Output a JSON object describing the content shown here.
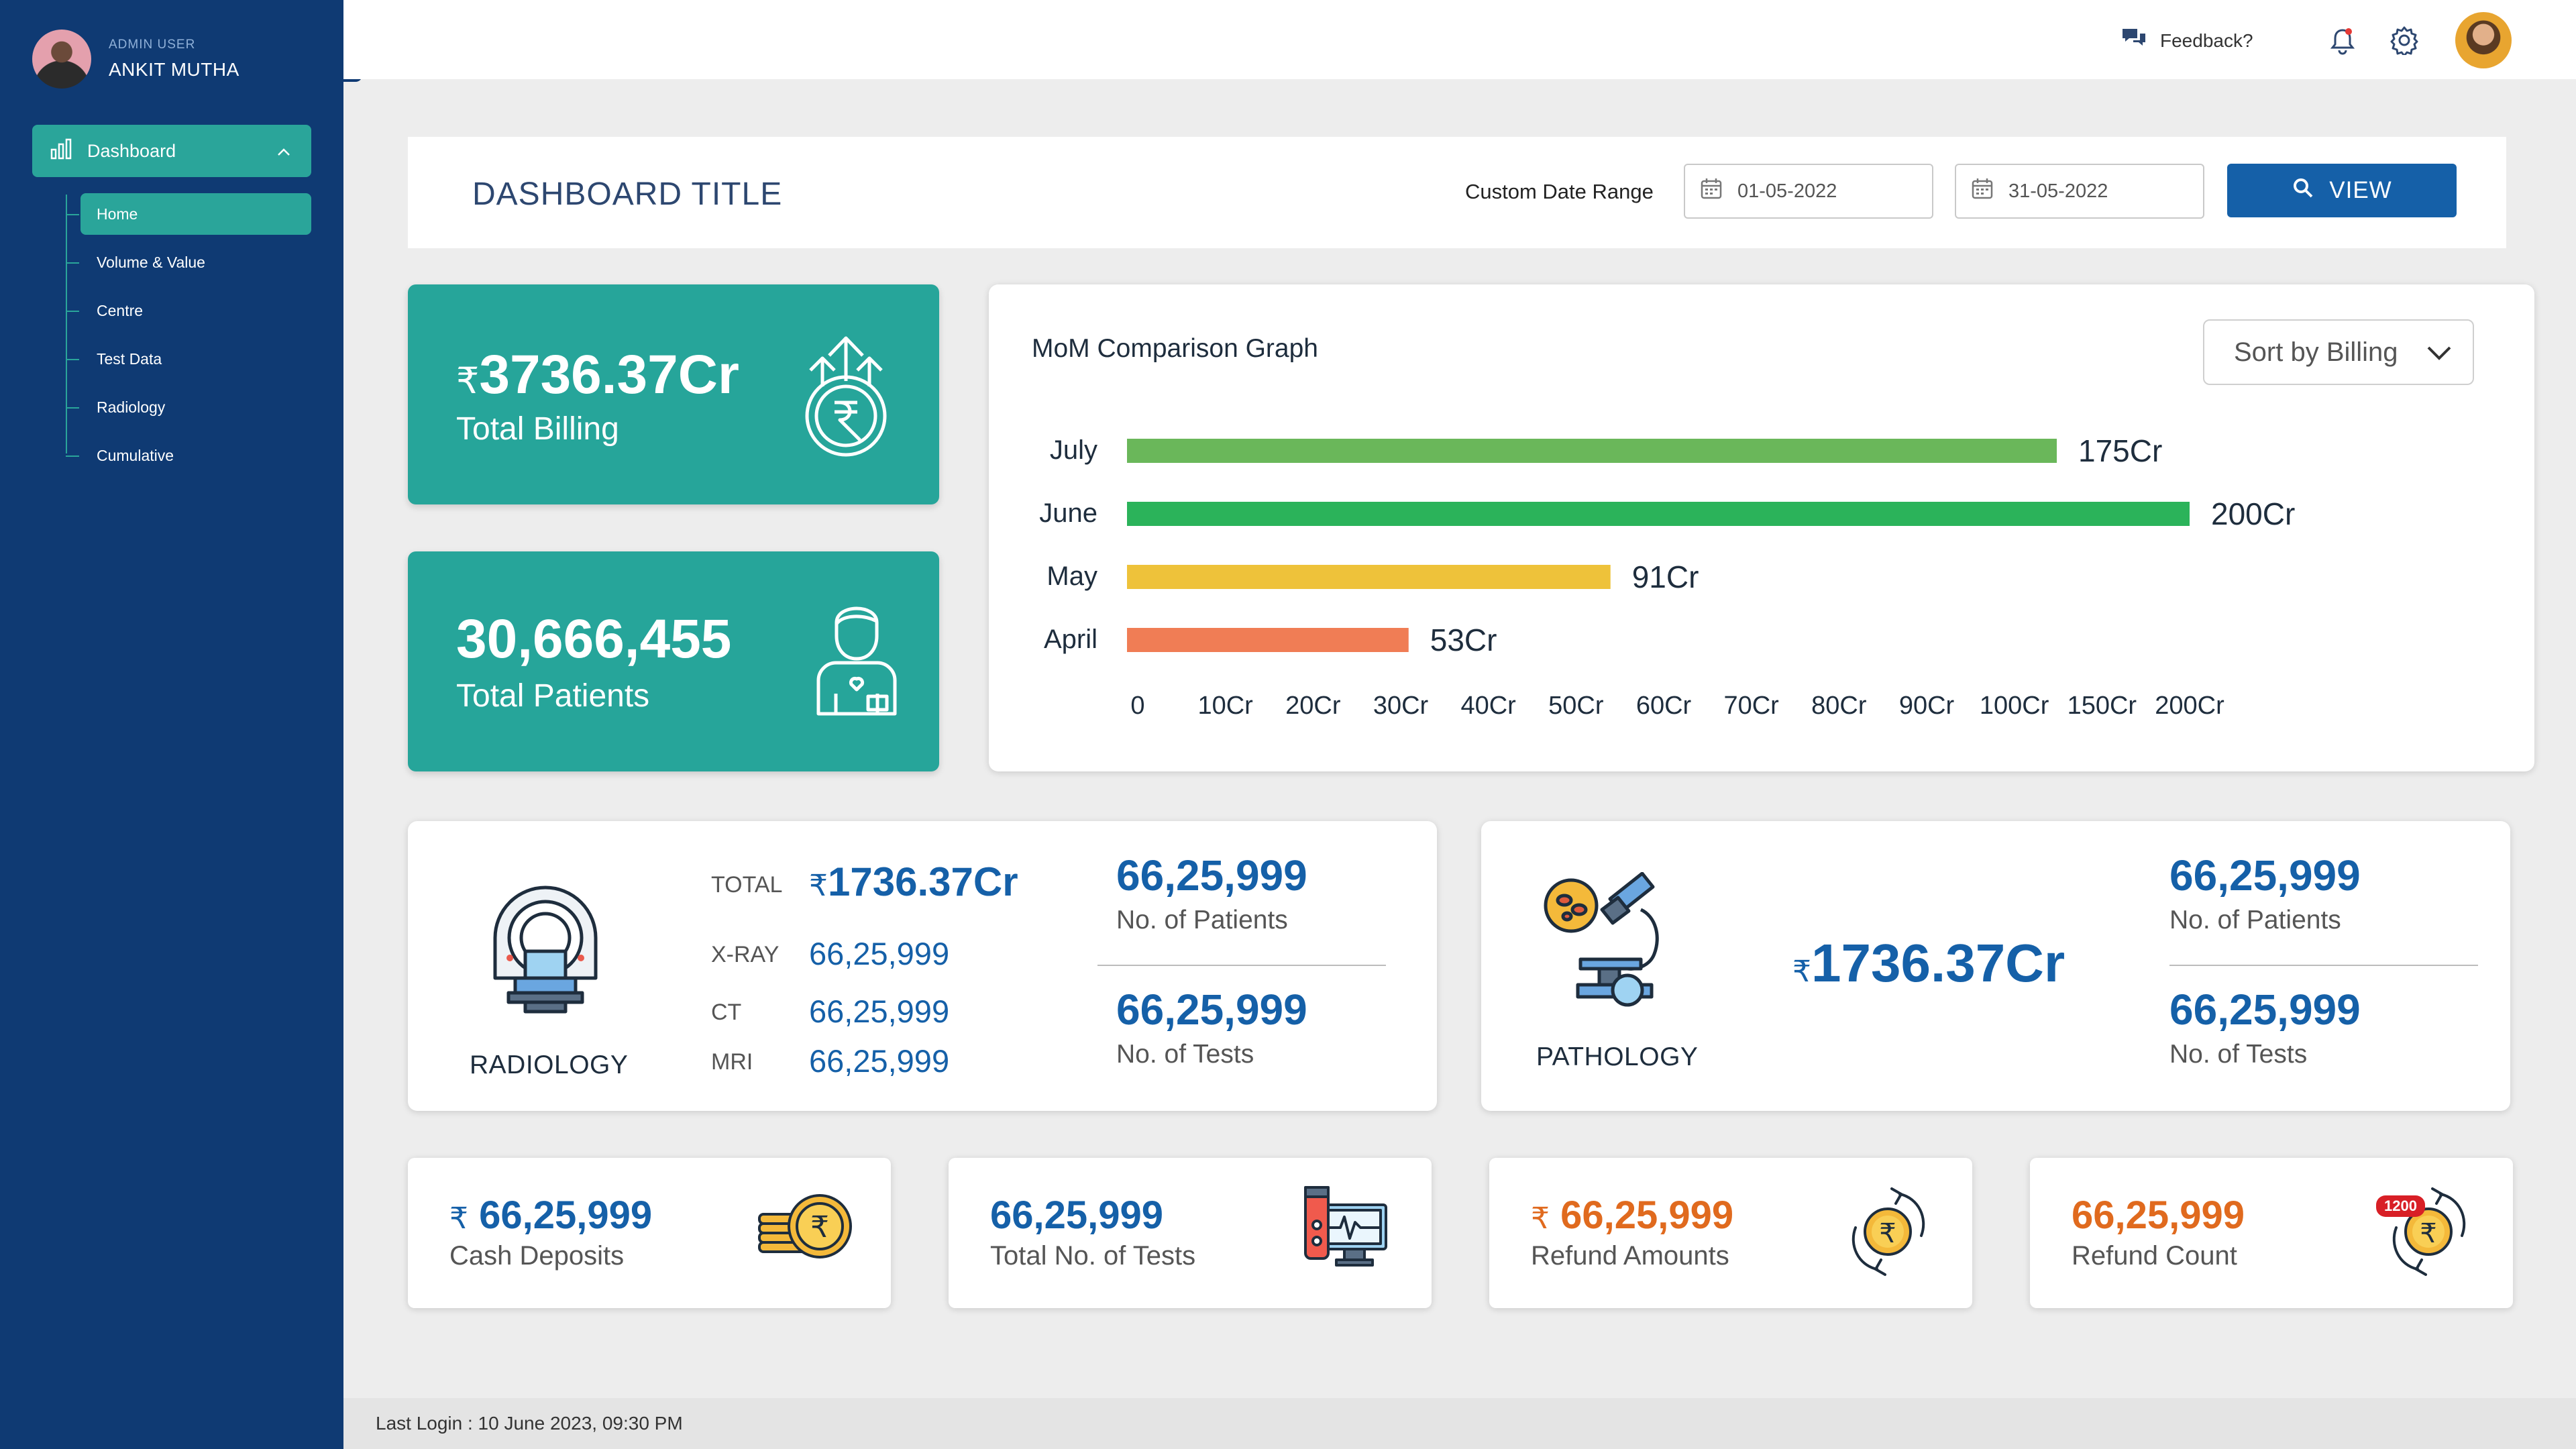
{
  "sidebar": {
    "user_role": "ADMIN USER",
    "user_name": "ANKIT MUTHA",
    "dashboard_label": "Dashboard",
    "items": [
      {
        "label": "Home"
      },
      {
        "label": "Volume & Value"
      },
      {
        "label": "Centre"
      },
      {
        "label": "Test Data"
      },
      {
        "label": "Radiology"
      },
      {
        "label": "Cumulative"
      }
    ]
  },
  "topbar": {
    "feedback_label": "Feedback?"
  },
  "titlebar": {
    "title": "DASHBOARD TITLE",
    "range_label": "Custom Date Range",
    "from_date": "01-05-2022",
    "to_date": "31-05-2022",
    "view_label": "VIEW"
  },
  "stats": {
    "billing_symbol": "₹",
    "billing_value": "3736.37Cr",
    "billing_label": "Total Billing",
    "patients_value": "30,666,455",
    "patients_label": "Total Patients"
  },
  "chart": {
    "title": "MoM Comparison Graph",
    "sort_label": "Sort by Billing"
  },
  "chart_data": {
    "type": "bar",
    "orientation": "horizontal",
    "categories": [
      "July",
      "June",
      "May",
      "April"
    ],
    "values": [
      175,
      200,
      91,
      53
    ],
    "value_labels": [
      "175Cr",
      "200Cr",
      "91Cr",
      "53Cr"
    ],
    "colors": [
      "#6ab75a",
      "#2bb35a",
      "#eec23a",
      "#f07d55"
    ],
    "x_ticks": [
      "0",
      "10Cr",
      "20Cr",
      "30Cr",
      "40Cr",
      "50Cr",
      "60Cr",
      "70Cr",
      "80Cr",
      "90Cr",
      "100Cr",
      "150Cr",
      "200Cr"
    ],
    "xlim": [
      0,
      200
    ],
    "grid": false,
    "legend": "none"
  },
  "radiology": {
    "name": "RADIOLOGY",
    "total_label": "TOTAL",
    "total_symbol": "₹",
    "total_value": "1736.37Cr",
    "rows": [
      {
        "label": "X-RAY",
        "value": "66,25,999"
      },
      {
        "label": "CT",
        "value": "66,25,999"
      },
      {
        "label": "MRI",
        "value": "66,25,999"
      }
    ],
    "patients_value": "66,25,999",
    "patients_label": "No. of Patients",
    "tests_value": "66,25,999",
    "tests_label": "No. of  Tests"
  },
  "pathology": {
    "name": "PATHOLOGY",
    "total_symbol": "₹",
    "total_value": "1736.37Cr",
    "patients_value": "66,25,999",
    "patients_label": "No. of Patients",
    "tests_value": "66,25,999",
    "tests_label": "No. of  Tests"
  },
  "bottom_cards": [
    {
      "symbol": "₹",
      "value": "66,25,999",
      "label": "Cash Deposits",
      "color": "#1560a8"
    },
    {
      "symbol": "",
      "value": "66,25,999",
      "label": "Total No. of Tests",
      "color": "#1560a8"
    },
    {
      "symbol": "₹",
      "value": "66,25,999",
      "label": "Refund Amounts",
      "color": "#e06a1e"
    },
    {
      "symbol": "",
      "value": "66,25,999",
      "label": "Refund Count",
      "color": "#e06a1e",
      "badge": "1200"
    }
  ],
  "footer": {
    "last_login": "Last Login : 10 June 2023, 09:30 PM"
  },
  "colors": {
    "sidebar": "#0f3a73",
    "accent": "#2aa59a",
    "primary": "#1560a8",
    "orange": "#e06a1e"
  }
}
